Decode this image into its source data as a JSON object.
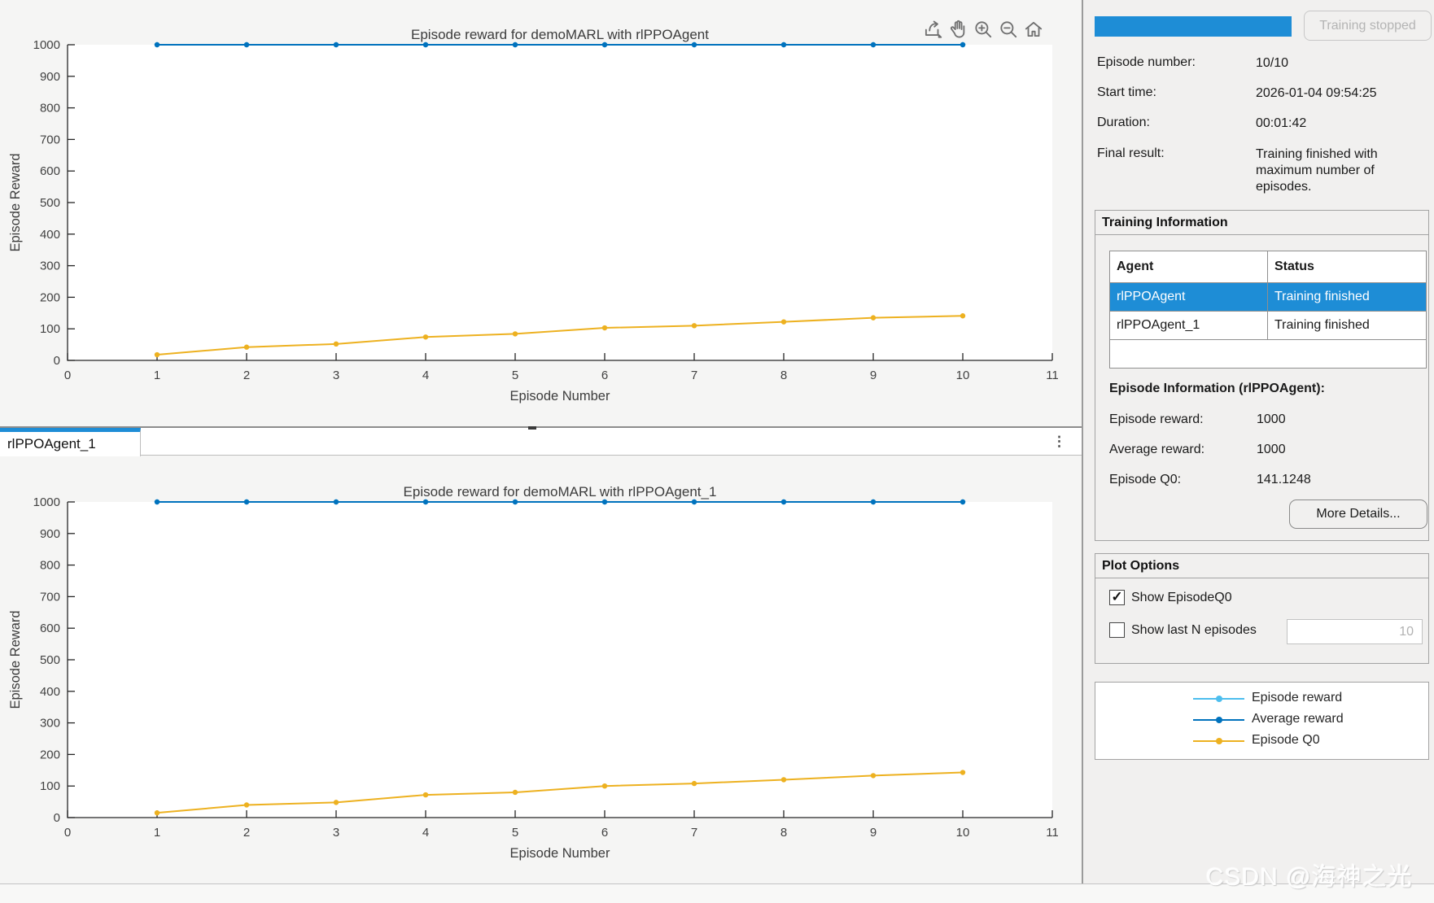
{
  "window": {
    "watermark": "CSDN @海神之光"
  },
  "toolbar": {
    "icons": [
      "export-icon",
      "pan-icon",
      "zoom-in-icon",
      "zoom-out-icon",
      "home-icon"
    ]
  },
  "tabs": {
    "active_label": "rlPPOAgent_1",
    "overflow_glyph": "⋮"
  },
  "status": {
    "progress_percent": 100,
    "stop_button": "Training stopped",
    "fields": [
      {
        "label": "Episode number:",
        "value": "10/10"
      },
      {
        "label": "Start time:",
        "value": "2026-01-04 09:54:25"
      },
      {
        "label": "Duration:",
        "value": "00:01:42"
      },
      {
        "label": "Final result:",
        "value": "Training finished with maximum number of episodes."
      }
    ]
  },
  "training_information": {
    "title": "Training Information",
    "table": {
      "headers": [
        "Agent",
        "Status"
      ],
      "rows": [
        {
          "agent": "rlPPOAgent",
          "status": "Training finished",
          "selected": true
        },
        {
          "agent": "rlPPOAgent_1",
          "status": "Training finished",
          "selected": false
        }
      ]
    },
    "episode_information": {
      "title": "Episode Information (rlPPOAgent):",
      "fields": [
        {
          "label": "Episode reward:",
          "value": "1000"
        },
        {
          "label": "Average reward:",
          "value": "1000"
        },
        {
          "label": "Episode Q0:",
          "value": "141.1248"
        }
      ],
      "more_details_button": "More Details..."
    }
  },
  "plot_options": {
    "title": "Plot Options",
    "show_episode_q0": {
      "label": "Show EpisodeQ0",
      "checked": true
    },
    "show_last_n": {
      "label": "Show last N episodes",
      "checked": false,
      "value": "10"
    }
  },
  "legend": {
    "position": "right-panel-bottom",
    "items": [
      {
        "label": "Episode reward",
        "color": "#4DBEEE"
      },
      {
        "label": "Average reward",
        "color": "#0072BD"
      },
      {
        "label": "Episode Q0",
        "color": "#EDB120"
      }
    ]
  },
  "chart_data": [
    {
      "type": "line",
      "title": "Episode reward for demoMARL with rlPPOAgent",
      "xlabel": "Episode Number",
      "ylabel": "Episode Reward",
      "xlim": [
        0,
        11
      ],
      "ylim": [
        0,
        1000
      ],
      "xticks": [
        0,
        1,
        2,
        3,
        4,
        5,
        6,
        7,
        8,
        9,
        10,
        11
      ],
      "yticks": [
        0,
        100,
        200,
        300,
        400,
        500,
        600,
        700,
        800,
        900,
        1000
      ],
      "grid": false,
      "x": [
        1,
        2,
        3,
        4,
        5,
        6,
        7,
        8,
        9,
        10
      ],
      "series": [
        {
          "name": "Episode reward",
          "color": "#4DBEEE",
          "values": [
            1000,
            1000,
            1000,
            1000,
            1000,
            1000,
            1000,
            1000,
            1000,
            1000
          ]
        },
        {
          "name": "Average reward",
          "color": "#0072BD",
          "values": [
            1000,
            1000,
            1000,
            1000,
            1000,
            1000,
            1000,
            1000,
            1000,
            1000
          ]
        },
        {
          "name": "Episode Q0",
          "color": "#EDB120",
          "values": [
            18,
            42,
            52,
            74,
            84,
            103,
            110,
            122,
            135,
            141.1248
          ]
        }
      ]
    },
    {
      "type": "line",
      "title": "Episode reward for demoMARL with rlPPOAgent_1",
      "xlabel": "Episode Number",
      "ylabel": "Episode Reward",
      "xlim": [
        0,
        11
      ],
      "ylim": [
        0,
        1000
      ],
      "xticks": [
        0,
        1,
        2,
        3,
        4,
        5,
        6,
        7,
        8,
        9,
        10,
        11
      ],
      "yticks": [
        0,
        100,
        200,
        300,
        400,
        500,
        600,
        700,
        800,
        900,
        1000
      ],
      "grid": false,
      "x": [
        1,
        2,
        3,
        4,
        5,
        6,
        7,
        8,
        9,
        10
      ],
      "series": [
        {
          "name": "Episode reward",
          "color": "#4DBEEE",
          "values": [
            1000,
            1000,
            1000,
            1000,
            1000,
            1000,
            1000,
            1000,
            1000,
            1000
          ]
        },
        {
          "name": "Average reward",
          "color": "#0072BD",
          "values": [
            1000,
            1000,
            1000,
            1000,
            1000,
            1000,
            1000,
            1000,
            1000,
            1000
          ]
        },
        {
          "name": "Episode Q0",
          "color": "#EDB120",
          "values": [
            15,
            40,
            48,
            72,
            80,
            100,
            108,
            120,
            133,
            143
          ]
        }
      ]
    }
  ]
}
